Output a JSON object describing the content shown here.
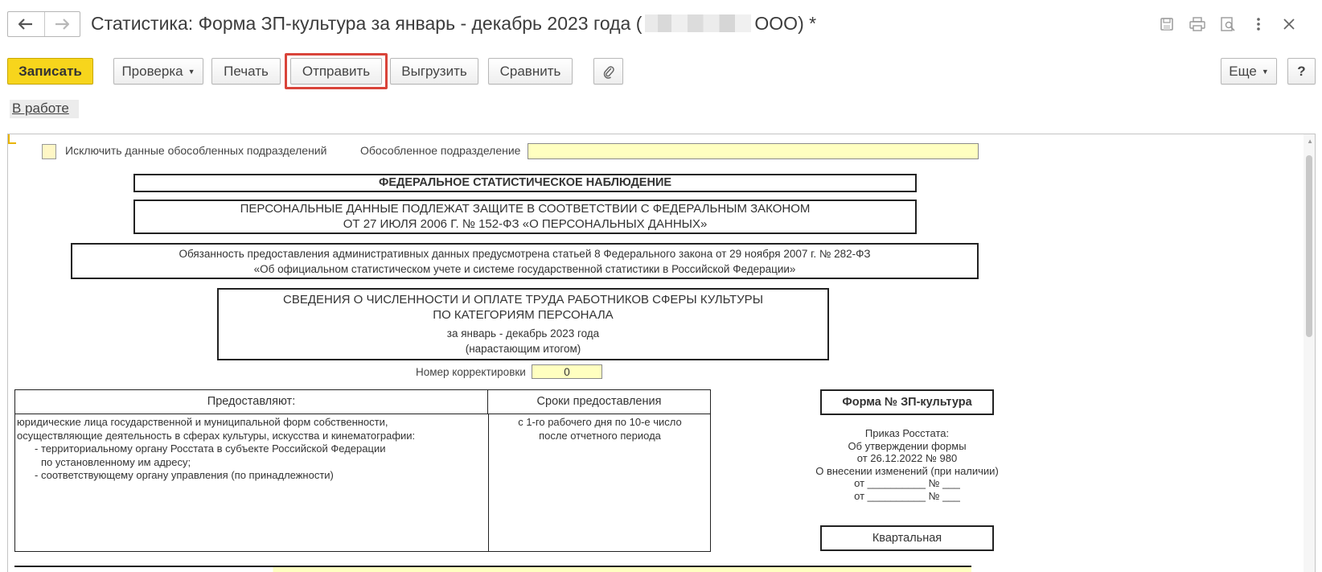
{
  "window": {
    "title_prefix": "Статистика: Форма ЗП-культура за январь - декабрь 2023 года (",
    "title_suffix": "ООО) *"
  },
  "toolbar": {
    "save_label": "Записать",
    "check_label": "Проверка",
    "print_label": "Печать",
    "send_label": "Отправить",
    "export_label": "Выгрузить",
    "compare_label": "Сравнить",
    "more_label": "Еще",
    "help_label": "?"
  },
  "status": {
    "label": "В работе"
  },
  "form": {
    "exclude_label": "Исключить данные обособленных подразделений",
    "subdivision_label": "Обособленное подразделение",
    "subdivision_value": "",
    "federal_header": "ФЕДЕРАЛЬНОЕ СТАТИСТИЧЕСКОЕ НАБЛЮДЕНИЕ",
    "personal_data_line1": "ПЕРСОНАЛЬНЫЕ ДАННЫЕ ПОДЛЕЖАТ ЗАЩИТЕ В СООТВЕТСТВИИ С ФЕДЕРАЛЬНЫМ ЗАКОНОМ",
    "personal_data_line2": "ОТ 27 ИЮЛЯ 2006 Г. № 152-ФЗ «О ПЕРСОНАЛЬНЫХ ДАННЫХ»",
    "obligation_line1": "Обязанность предоставления административных данных предусмотрена статьей 8 Федерального закона от 29 ноября 2007 г. № 282-ФЗ",
    "obligation_line2": "«Об официальном статистическом учете и системе государственной статистики в Российской Федерации»",
    "info_line1": "СВЕДЕНИЯ О ЧИСЛЕННОСТИ И ОПЛАТЕ ТРУДА РАБОТНИКОВ СФЕРЫ КУЛЬТУРЫ",
    "info_line2": "ПО КАТЕГОРИЯМ ПЕРСОНАЛА",
    "period_line": "за январь - декабрь 2023 года",
    "cumulative_line": "(нарастающим итогом)",
    "correction_label": "Номер корректировки",
    "correction_value": "0",
    "table": {
      "col1_header": "Предоставляют:",
      "col2_header": "Сроки предоставления",
      "col1_lines": [
        "юридические лица государственной и муниципальной форм собственности,",
        "осуществляющие деятельность в сферах культуры, искусства и кинематографии:",
        "- территориальному органу Росстата в субъекте Российской Федерации",
        "по установленному им адресу;",
        "- соответствующему органу управления (по принадлежности)"
      ],
      "col2_lines": [
        "с 1-го рабочего дня по 10-е число",
        "после отчетного периода"
      ]
    },
    "form_number": "Форма № ЗП-культура",
    "order_lines": [
      "Приказ Росстата:",
      "Об утверждении формы",
      "от 26.12.2022 № 980",
      "О внесении изменений (при наличии)",
      "от __________ № ___",
      "от __________ № ___"
    ],
    "periodicity": "Квартальная"
  }
}
